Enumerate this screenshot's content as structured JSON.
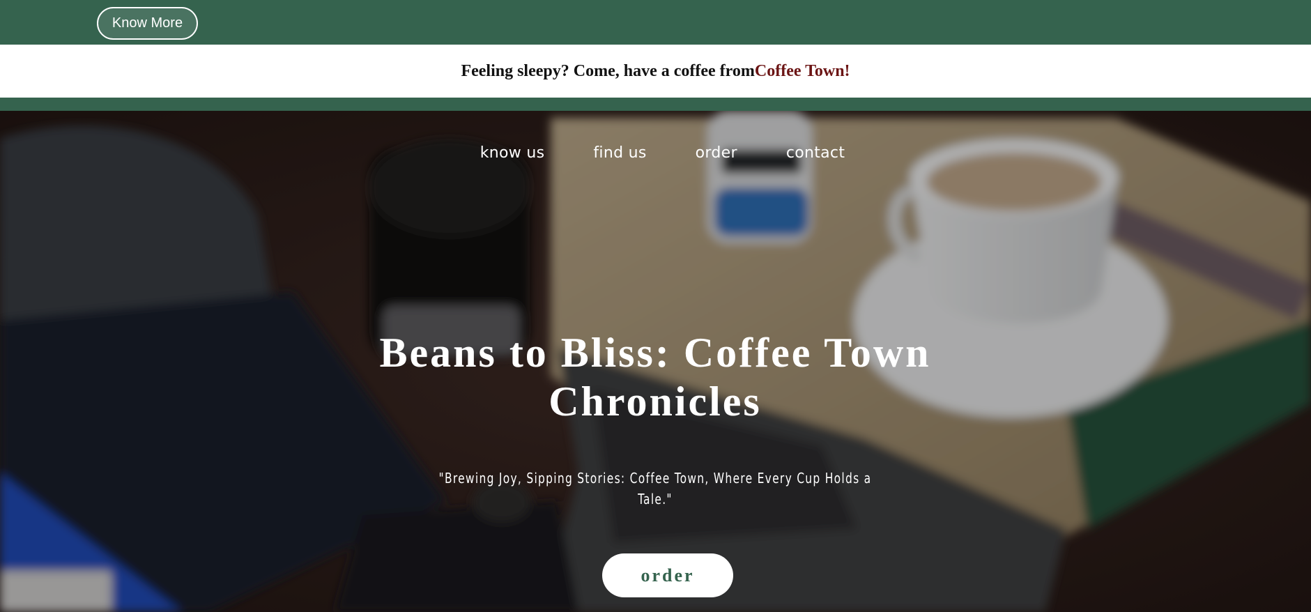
{
  "header": {
    "know_more_label": "Know More"
  },
  "banner": {
    "text_before": "Feeling sleepy? Come, have a coffee from ",
    "brand": "Coffee Town",
    "text_after": "!"
  },
  "nav": {
    "items": [
      {
        "label": "know us"
      },
      {
        "label": "find us"
      },
      {
        "label": "order"
      },
      {
        "label": "contact"
      }
    ]
  },
  "hero": {
    "title": "Beans to Bliss: Coffee Town Chronicles",
    "tagline": "\"Brewing Joy, Sipping Stories: Coffee Town, Where Every Cup Holds a Tale.\"",
    "order_label": "order"
  },
  "colors": {
    "brand_green": "#35634e",
    "brand_red": "#6b1414",
    "white": "#ffffff"
  }
}
